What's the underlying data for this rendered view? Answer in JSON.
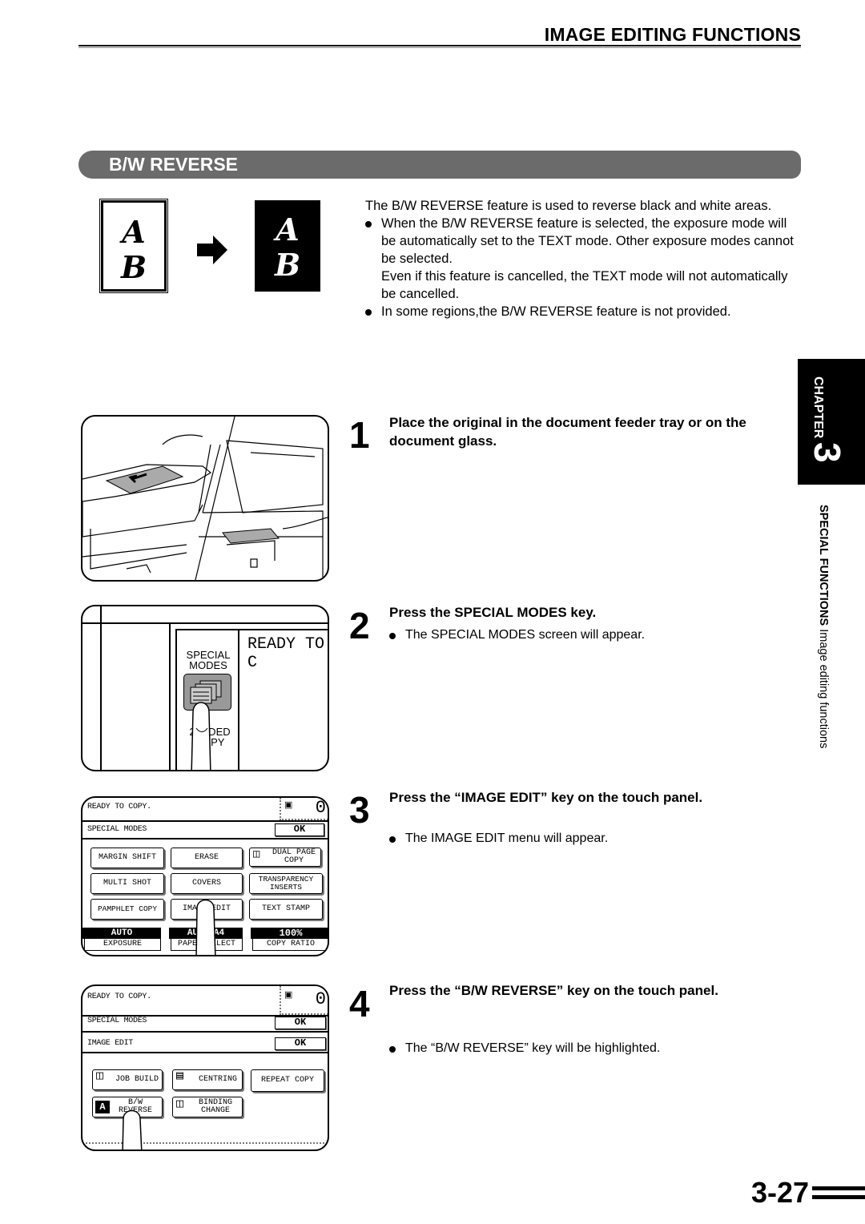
{
  "header": {
    "title": "IMAGE EDITING FUNCTIONS"
  },
  "section": {
    "title": "B/W REVERSE"
  },
  "illustration_ab": {
    "letter_a": "A",
    "letter_b": "B"
  },
  "intro": {
    "lead": "The B/W REVERSE feature is used to reverse black and white areas.",
    "bullets": [
      {
        "text": "When the B/W REVERSE feature is selected, the exposure mode will be automatically set to the TEXT mode. Other exposure modes cannot be selected.",
        "continuation": "Even if this feature is cancelled, the TEXT mode will not automatically be cancelled."
      },
      {
        "text": "In some regions,the B/W REVERSE feature is not provided."
      }
    ]
  },
  "chapter_tab": {
    "label": "CHAPTER",
    "number": "3",
    "section": "SPECIAL FUNCTIONS",
    "subsection": "Image editing functions"
  },
  "steps": [
    {
      "number": "1",
      "heading": "Place the original in the document feeder tray or on the document glass.",
      "note": ""
    },
    {
      "number": "2",
      "heading": "Press the SPECIAL MODES key.",
      "note": "The SPECIAL MODES screen will appear."
    },
    {
      "number": "3",
      "heading": "Press the “IMAGE EDIT” key on the touch panel.",
      "note": "The IMAGE EDIT menu will appear."
    },
    {
      "number": "4",
      "heading": "Press the “B/W REVERSE” key on the touch panel.",
      "note": "The “B/W REVERSE” key will be highlighted."
    }
  ],
  "panel_illustration": {
    "key_label_line1": "SPECIAL",
    "key_label_line2": "MODES",
    "lower_label_line1": "2-SIDED",
    "lower_label_line2": "COPY",
    "display_text": "READY TO C"
  },
  "touch_panel_1": {
    "status": "READY TO COPY.",
    "count": "0",
    "menu_title": "SPECIAL MODES",
    "ok": "OK",
    "keys": [
      [
        "MARGIN SHIFT",
        "ERASE",
        "DUAL PAGE COPY"
      ],
      [
        "MULTI SHOT",
        "COVERS",
        "TRANSPARENCY INSERTS"
      ],
      [
        "PAMPHLET COPY",
        "IMAGE EDIT",
        "TEXT STAMP"
      ]
    ],
    "status_bar": [
      {
        "value": "AUTO",
        "label": "EXPOSURE"
      },
      {
        "value": "AUTO A4",
        "label": "PAPER SELECT"
      },
      {
        "value": "100%",
        "label": "COPY RATIO"
      }
    ]
  },
  "touch_panel_2": {
    "status": "READY TO COPY.",
    "count": "0",
    "menu_title": "SPECIAL MODES",
    "submenu_title": "IMAGE EDIT",
    "ok": "OK",
    "keys": [
      [
        "JOB BUILD",
        "CENTRING",
        "REPEAT COPY"
      ],
      [
        "B/W REVERSE",
        "BINDING CHANGE"
      ]
    ]
  },
  "footer": {
    "page_number": "3-27"
  }
}
